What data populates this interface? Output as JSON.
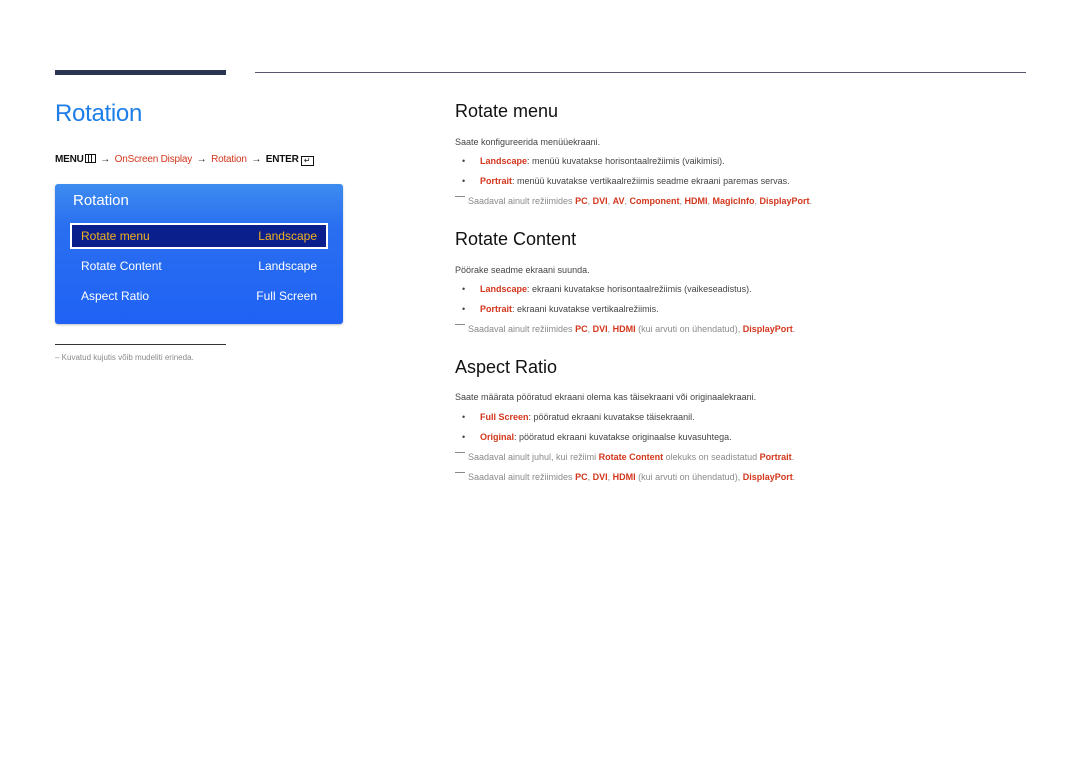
{
  "page": {
    "title": "Rotation",
    "breadcrumb": {
      "menu": "MENU",
      "arrow": "→",
      "item1": "OnScreen Display",
      "item2": "Rotation",
      "enter": "ENTER"
    },
    "osd": {
      "title": "Rotation",
      "rows": [
        {
          "label": "Rotate menu",
          "value": "Landscape",
          "selected": true
        },
        {
          "label": "Rotate Content",
          "value": "Landscape",
          "selected": false
        },
        {
          "label": "Aspect Ratio",
          "value": "Full Screen",
          "selected": false
        }
      ]
    },
    "footnote": "–  Kuvatud kujutis võib mudeliti erineda."
  },
  "sections": {
    "rotate_menu": {
      "title": "Rotate menu",
      "intro": "Saate konfigureerida menüüekraani.",
      "bullets": [
        {
          "term": "Landscape",
          "text": ": menüü kuvatakse horisontaalrežiimis (vaikimisi)."
        },
        {
          "term": "Portrait",
          "text": ": menüü kuvatakse vertikaalrežiimis seadme ekraani paremas servas."
        }
      ],
      "note": {
        "prefix": "Saadaval ainult režiimides ",
        "items": [
          "PC",
          "DVI",
          "AV",
          "Component",
          "HDMI",
          "MagicInfo",
          "DisplayPort"
        ],
        "sep": ", ",
        "end": "."
      }
    },
    "rotate_content": {
      "title": "Rotate Content",
      "intro": "Pöörake seadme ekraani suunda.",
      "bullets": [
        {
          "term": "Landscape",
          "text": ": ekraani kuvatakse horisontaalrežiimis (vaikeseadistus)."
        },
        {
          "term": "Portrait",
          "text": ": ekraani kuvatakse vertikaalrežiimis."
        }
      ],
      "note": {
        "prefix": "Saadaval ainult režiimides ",
        "pc": "PC",
        "dvi": "DVI",
        "hdmi": "HDMI",
        "hdmi_suffix": " (kui arvuti on ühendatud), ",
        "dp": "DisplayPort",
        "sep": ", ",
        "end": "."
      }
    },
    "aspect_ratio": {
      "title": "Aspect Ratio",
      "intro": "Saate määrata pööratud ekraani olema kas täisekraani või originaalekraani.",
      "bullets": [
        {
          "term": "Full Screen",
          "text": ": pööratud ekraani kuvatakse täisekraanil."
        },
        {
          "term": "Original",
          "text": ": pööratud ekraani kuvatakse originaalse kuvasuhtega."
        }
      ],
      "note1": {
        "prefix": "Saadaval ainult juhul, kui režiimi ",
        "term1": "Rotate Content",
        "mid": " olekuks on seadistatud ",
        "term2": "Portrait",
        "end": "."
      },
      "note2": {
        "prefix": "Saadaval ainult režiimides ",
        "pc": "PC",
        "dvi": "DVI",
        "hdmi": "HDMI",
        "hdmi_suffix": " (kui arvuti on ühendatud), ",
        "dp": "DisplayPort",
        "sep": ", ",
        "end": "."
      }
    }
  },
  "colors": {
    "title_blue": "#1e7ee8",
    "highlight_red": "#d3361c",
    "osd_blue": "#1f62f5",
    "osd_selected_bg": "#0a1f8c",
    "osd_selected_text": "#f2b21e"
  }
}
